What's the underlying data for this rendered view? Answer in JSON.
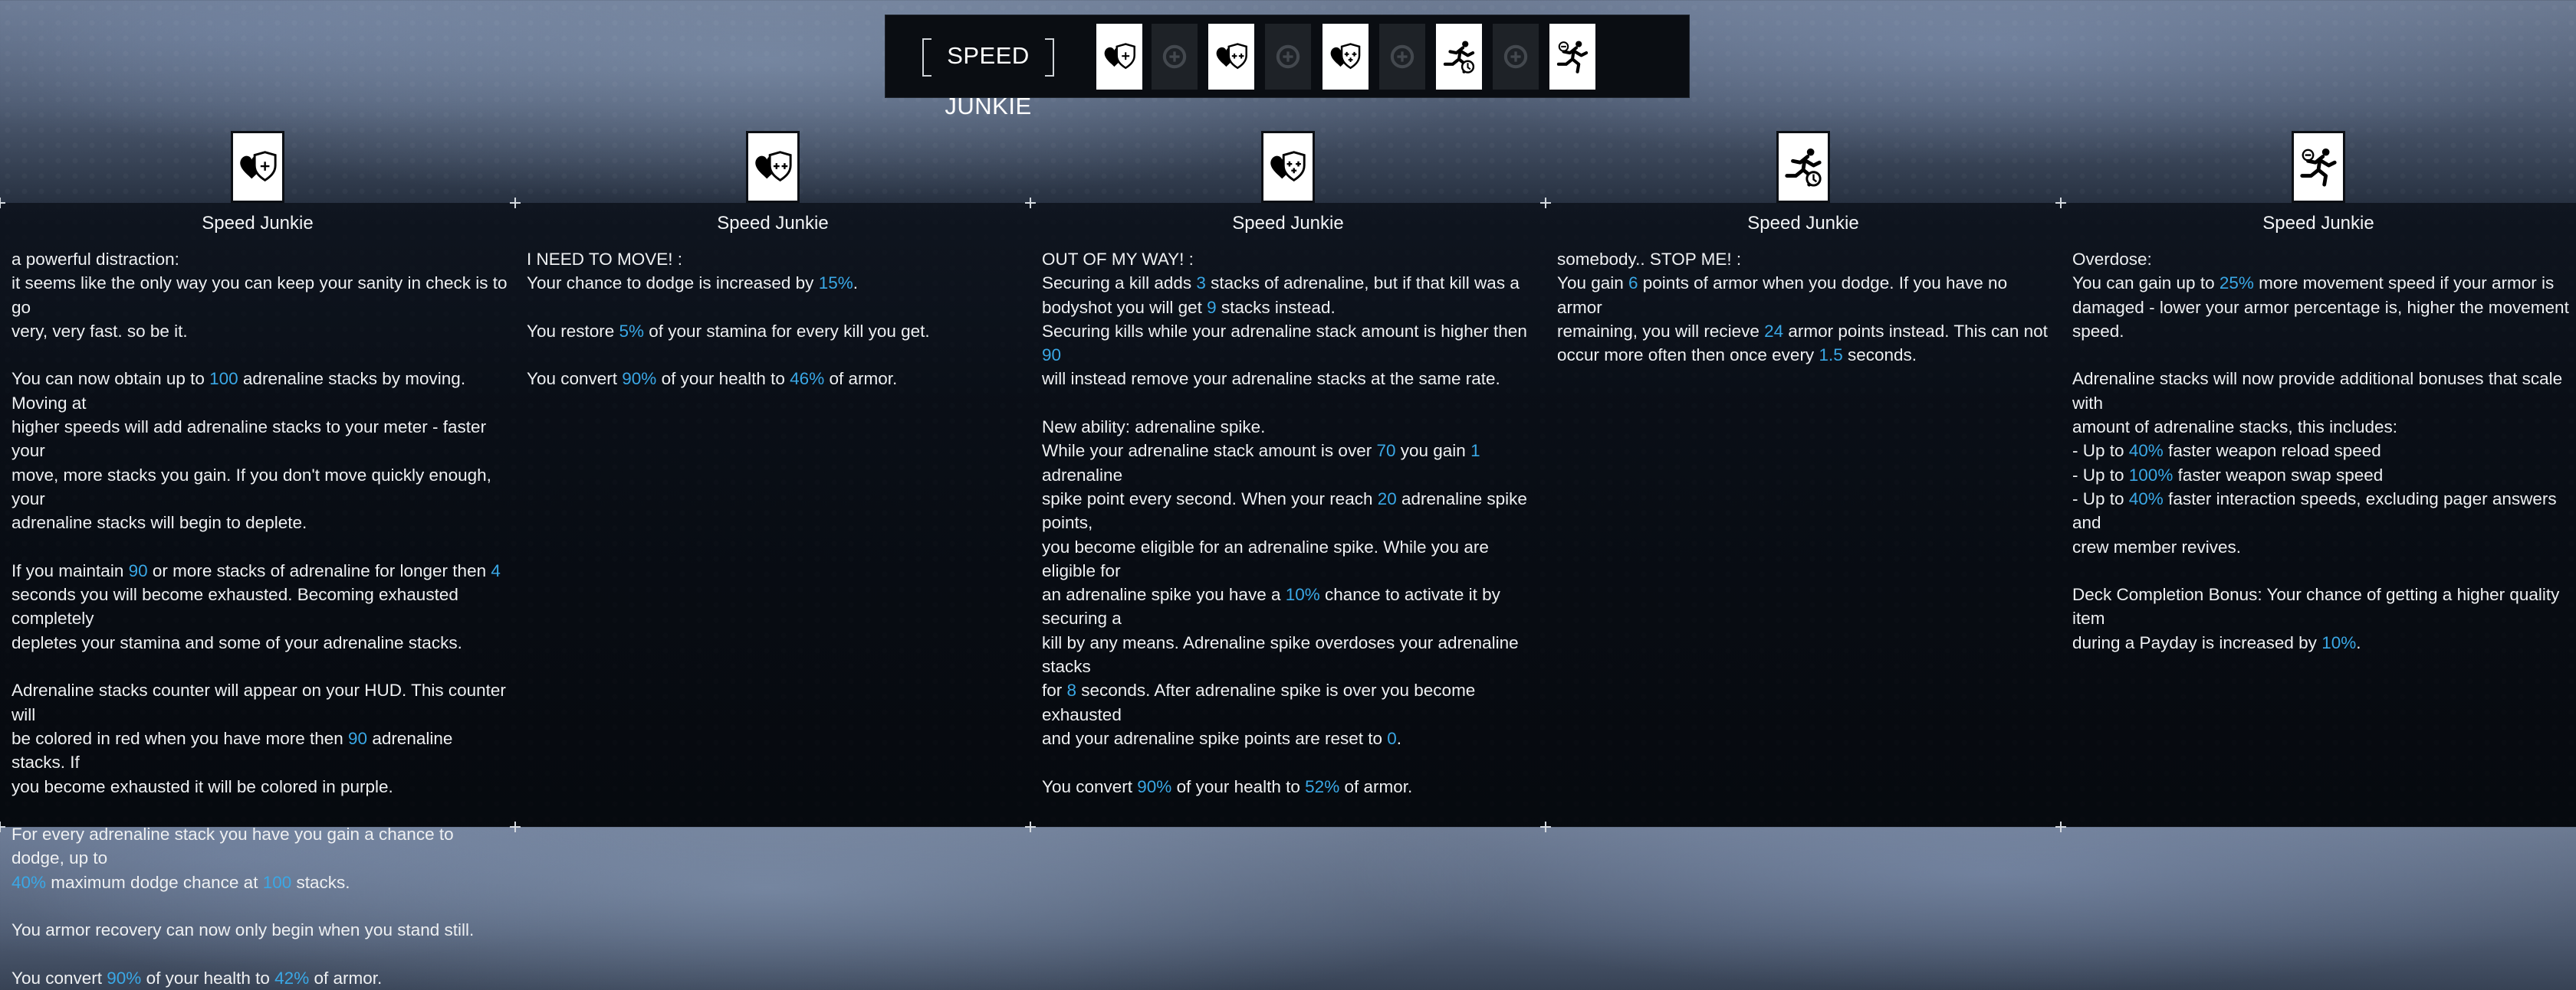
{
  "deck": {
    "title": "SPEED JUNKIE",
    "cards": [
      {
        "icon": "heart-shield-plus-icon",
        "active": true
      },
      {
        "icon": "perk-dim-icon-1",
        "active": false
      },
      {
        "icon": "heart-shield-double-plus-icon",
        "active": true
      },
      {
        "icon": "perk-dim-icon-2",
        "active": false
      },
      {
        "icon": "shield-plus-icon",
        "active": true
      },
      {
        "icon": "perk-dim-icon-3",
        "active": false
      },
      {
        "icon": "running-man-shield-icon",
        "active": true
      },
      {
        "icon": "perk-dim-icon-4",
        "active": false
      },
      {
        "icon": "running-man-icon",
        "active": true
      }
    ]
  },
  "accent_color": "#3aa8e6",
  "panels": [
    {
      "title": "Speed Junkie",
      "icon": "heart-shield-plus-icon",
      "body": [
        {
          "t": "a powerful distraction:\nit seems like the only way you can keep your sanity in check is to go\nvery, very fast. so be it.\n\nYou can now obtain up to "
        },
        {
          "t": "100",
          "hl": true
        },
        {
          "t": " adrenaline stacks by moving. Moving at\nhigher speeds will add adrenaline stacks to your meter - faster your\nmove, more stacks you gain. If you don't move quickly enough, your\nadrenaline stacks will begin to deplete.\n\nIf you maintain "
        },
        {
          "t": "90",
          "hl": true
        },
        {
          "t": " or more stacks of adrenaline for longer then "
        },
        {
          "t": "4",
          "hl": true
        },
        {
          "t": "\nseconds you will become exhausted. Becoming exhausted completely\ndepletes your stamina and some of your adrenaline stacks.\n\nAdrenaline stacks counter will appear on your HUD. This counter will\nbe colored in red when you have more then "
        },
        {
          "t": "90",
          "hl": true
        },
        {
          "t": " adrenaline stacks. If\nyou become exhausted it will be colored in purple.\n\nFor every adrenaline stack you have you gain a chance to dodge, up to\n"
        },
        {
          "t": "40%",
          "hl": true
        },
        {
          "t": " maximum dodge chance at "
        },
        {
          "t": "100",
          "hl": true
        },
        {
          "t": " stacks.\n\nYou armor recovery can now only begin when you stand still.\n\nYou convert "
        },
        {
          "t": "90%",
          "hl": true
        },
        {
          "t": " of your health to "
        },
        {
          "t": "42%",
          "hl": true
        },
        {
          "t": " of armor."
        }
      ]
    },
    {
      "title": "Speed Junkie",
      "icon": "heart-shield-double-plus-icon",
      "body": [
        {
          "t": "I NEED TO MOVE! :\nYour chance to dodge is increased by "
        },
        {
          "t": "15%",
          "hl": true
        },
        {
          "t": ".\n\nYou restore "
        },
        {
          "t": "5%",
          "hl": true
        },
        {
          "t": " of your stamina for every kill you get.\n\nYou convert "
        },
        {
          "t": "90%",
          "hl": true
        },
        {
          "t": " of your health to "
        },
        {
          "t": "46%",
          "hl": true
        },
        {
          "t": " of armor."
        }
      ]
    },
    {
      "title": "Speed Junkie",
      "icon": "shield-plus-icon",
      "body": [
        {
          "t": "OUT OF MY WAY! :\nSecuring a kill adds "
        },
        {
          "t": "3",
          "hl": true
        },
        {
          "t": " stacks of adrenaline, but if that kill was a\nbodyshot you will get "
        },
        {
          "t": "9",
          "hl": true
        },
        {
          "t": " stacks instead.\nSecuring kills while your adrenaline stack amount is higher then "
        },
        {
          "t": "90",
          "hl": true
        },
        {
          "t": "\nwill instead remove your adrenaline stacks at the same rate.\n\nNew ability: adrenaline spike.\nWhile your adrenaline stack amount is over "
        },
        {
          "t": "70",
          "hl": true
        },
        {
          "t": " you gain "
        },
        {
          "t": "1",
          "hl": true
        },
        {
          "t": " adrenaline\nspike point every second. When your reach "
        },
        {
          "t": "20",
          "hl": true
        },
        {
          "t": " adrenaline spike points,\nyou become eligible for an adrenaline spike. While you are eligible for\nan adrenaline spike you have a "
        },
        {
          "t": "10%",
          "hl": true
        },
        {
          "t": " chance to activate it by securing a\nkill by any means. Adrenaline spike overdoses your adrenaline stacks\nfor "
        },
        {
          "t": "8",
          "hl": true
        },
        {
          "t": " seconds. After adrenaline spike is over you become exhausted\nand your adrenaline spike points are reset to "
        },
        {
          "t": "0",
          "hl": true
        },
        {
          "t": ".\n\nYou convert "
        },
        {
          "t": "90%",
          "hl": true
        },
        {
          "t": " of your health to "
        },
        {
          "t": "52%",
          "hl": true
        },
        {
          "t": " of armor."
        }
      ]
    },
    {
      "title": "Speed Junkie",
      "icon": "running-man-shield-icon",
      "body": [
        {
          "t": "somebody.. STOP ME! :\nYou gain "
        },
        {
          "t": "6",
          "hl": true
        },
        {
          "t": " points of armor when you dodge. If you have no armor\nremaining, you will recieve "
        },
        {
          "t": "24",
          "hl": true
        },
        {
          "t": " armor points instead. This can not\noccur more often then once every "
        },
        {
          "t": "1.5",
          "hl": true
        },
        {
          "t": " seconds."
        }
      ]
    },
    {
      "title": "Speed Junkie",
      "icon": "running-man-icon",
      "body": [
        {
          "t": "Overdose:\nYou can gain up to "
        },
        {
          "t": "25%",
          "hl": true
        },
        {
          "t": " more movement speed if your armor is\ndamaged - lower your armor percentage is, higher the movement\nspeed.\n\nAdrenaline stacks will now provide additional bonuses that scale with\namount of adrenaline stacks, this includes:\n- Up to "
        },
        {
          "t": "40%",
          "hl": true
        },
        {
          "t": " faster weapon reload speed\n- Up to "
        },
        {
          "t": "100%",
          "hl": true
        },
        {
          "t": " faster weapon swap speed\n- Up to "
        },
        {
          "t": "40%",
          "hl": true
        },
        {
          "t": " faster interaction speeds, excluding pager answers and\ncrew member revives.\n\nDeck Completion Bonus: Your chance of getting a higher quality item\nduring a Payday is increased by "
        },
        {
          "t": "10%",
          "hl": true
        },
        {
          "t": "."
        }
      ]
    }
  ]
}
